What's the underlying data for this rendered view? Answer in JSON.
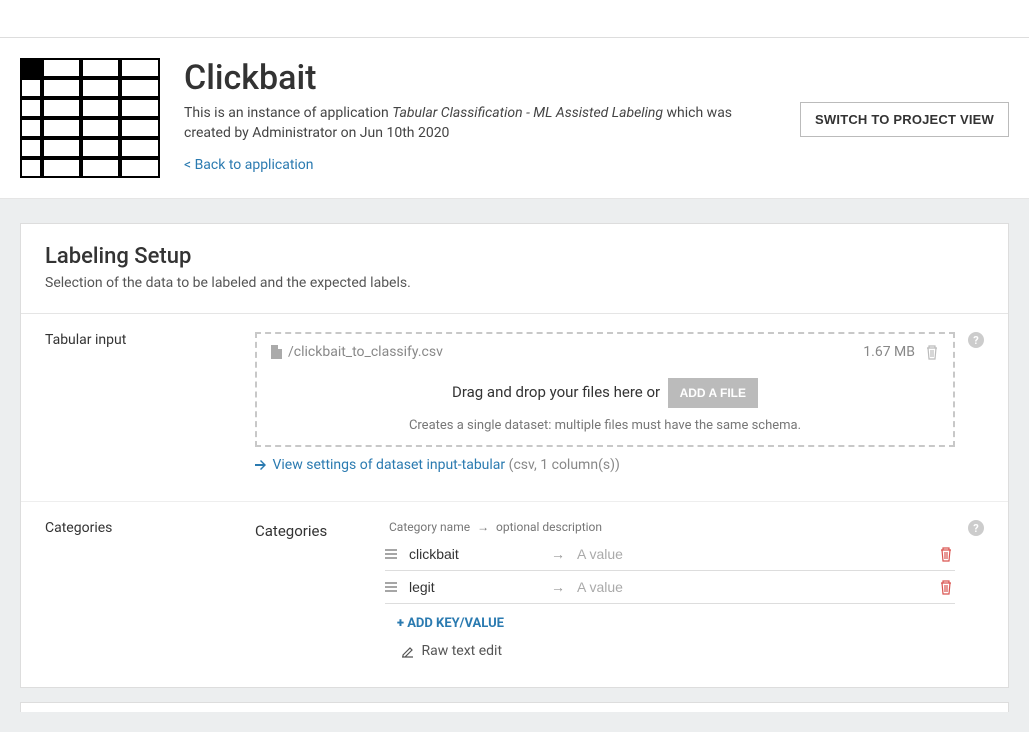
{
  "header": {
    "title": "Clickbait",
    "subtitle_prefix": "This is an instance of application ",
    "app_name": "Tabular Classification - ML Assisted Labeling",
    "subtitle_suffix": " which was created by Administrator on Jun 10th 2020",
    "back_link": "< Back to application",
    "switch_button": "SWITCH TO PROJECT VIEW"
  },
  "panel": {
    "title": "Labeling Setup",
    "subtitle": "Selection of the data to be labeled and the expected labels."
  },
  "tabular": {
    "label": "Tabular input",
    "file_name": "/clickbait_to_classify.csv",
    "file_size": "1.67 MB",
    "drop_text": "Drag and drop your files here or",
    "add_file": "ADD A FILE",
    "drop_hint": "Creates a single dataset: multiple files must have the same schema.",
    "view_link": "View settings of dataset input-tabular",
    "view_meta": "(csv, 1 column(s))"
  },
  "categories": {
    "label": "Categories",
    "sub_label": "Categories",
    "hint_name": "Category name",
    "hint_desc": "optional description",
    "value_placeholder": "A value",
    "rows": [
      {
        "key": "clickbait",
        "value": ""
      },
      {
        "key": "legit",
        "value": ""
      }
    ],
    "add_label": "ADD KEY/VALUE",
    "raw_edit": "Raw text edit"
  }
}
